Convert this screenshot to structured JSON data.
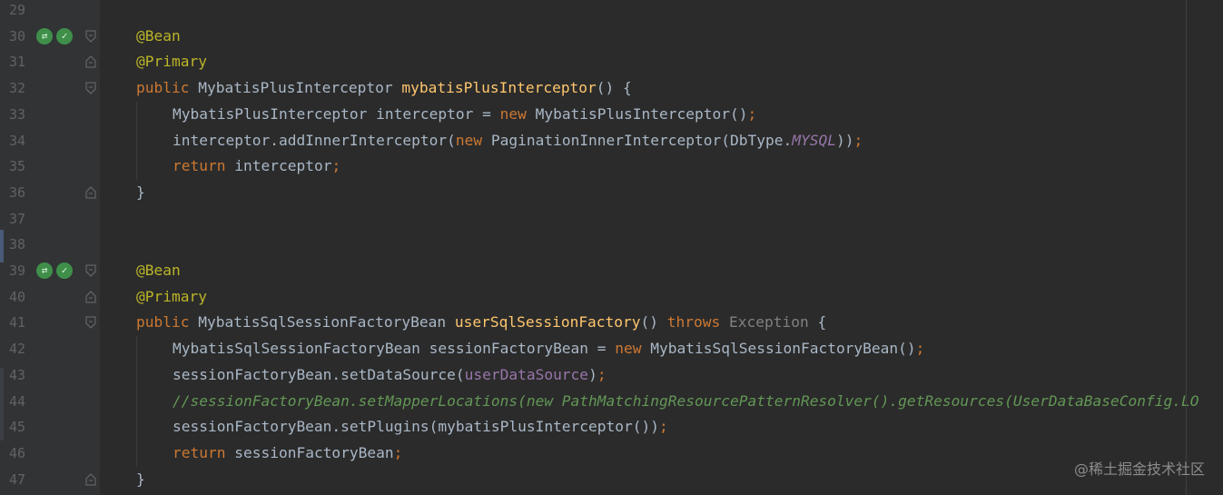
{
  "editor": {
    "lines": [
      {
        "num": "29",
        "icons": false,
        "fold": "",
        "indent": 0,
        "segments": []
      },
      {
        "num": "30",
        "icons": true,
        "fold": "open",
        "indent": 0,
        "segments": [
          {
            "t": "@Bean",
            "c": "ann"
          }
        ]
      },
      {
        "num": "31",
        "icons": false,
        "fold": "close",
        "indent": 0,
        "segments": [
          {
            "t": "@Primary",
            "c": "ann"
          }
        ]
      },
      {
        "num": "32",
        "icons": false,
        "fold": "open",
        "indent": 0,
        "segments": [
          {
            "t": "public ",
            "c": "kw"
          },
          {
            "t": "MybatisPlusInterceptor ",
            "c": "cls"
          },
          {
            "t": "mybatisPlusInterceptor",
            "c": "fn"
          },
          {
            "t": "() {",
            "c": "cls"
          }
        ]
      },
      {
        "num": "33",
        "icons": false,
        "fold": "",
        "indent": 1,
        "segments": [
          {
            "t": "MybatisPlusInterceptor interceptor = ",
            "c": "cls"
          },
          {
            "t": "new ",
            "c": "kw"
          },
          {
            "t": "MybatisPlusInterceptor()",
            "c": "cls"
          },
          {
            "t": ";",
            "c": "kw"
          }
        ]
      },
      {
        "num": "34",
        "icons": false,
        "fold": "",
        "indent": 1,
        "segments": [
          {
            "t": "interceptor.addInnerInterceptor(",
            "c": "cls"
          },
          {
            "t": "new ",
            "c": "kw"
          },
          {
            "t": "PaginationInnerInterceptor(DbType.",
            "c": "cls"
          },
          {
            "t": "MYSQL",
            "c": "field"
          },
          {
            "t": "))",
            "c": "cls"
          },
          {
            "t": ";",
            "c": "kw"
          }
        ]
      },
      {
        "num": "35",
        "icons": false,
        "fold": "",
        "indent": 1,
        "segments": [
          {
            "t": "return ",
            "c": "kw"
          },
          {
            "t": "interceptor",
            "c": "cls"
          },
          {
            "t": ";",
            "c": "kw"
          }
        ]
      },
      {
        "num": "36",
        "icons": false,
        "fold": "close",
        "indent": 0,
        "segments": [
          {
            "t": "}",
            "c": "cls"
          }
        ]
      },
      {
        "num": "37",
        "icons": false,
        "fold": "",
        "indent": 0,
        "segments": []
      },
      {
        "num": "38",
        "icons": false,
        "fold": "",
        "indent": 0,
        "segments": []
      },
      {
        "num": "39",
        "icons": true,
        "fold": "open",
        "indent": 0,
        "segments": [
          {
            "t": "@Bean",
            "c": "ann"
          }
        ]
      },
      {
        "num": "40",
        "icons": false,
        "fold": "close",
        "indent": 0,
        "segments": [
          {
            "t": "@Primary",
            "c": "ann"
          }
        ]
      },
      {
        "num": "41",
        "icons": false,
        "fold": "open",
        "indent": 0,
        "segments": [
          {
            "t": "public ",
            "c": "kw"
          },
          {
            "t": "MybatisSqlSessionFactoryBean ",
            "c": "cls"
          },
          {
            "t": "userSqlSessionFactory",
            "c": "fn"
          },
          {
            "t": "() ",
            "c": "cls"
          },
          {
            "t": "throws ",
            "c": "kw"
          },
          {
            "t": "Exception ",
            "c": "muted"
          },
          {
            "t": "{",
            "c": "cls"
          }
        ]
      },
      {
        "num": "42",
        "icons": false,
        "fold": "",
        "indent": 1,
        "segments": [
          {
            "t": "MybatisSqlSessionFactoryBean sessionFactoryBean = ",
            "c": "cls"
          },
          {
            "t": "new ",
            "c": "kw"
          },
          {
            "t": "MybatisSqlSessionFactoryBean()",
            "c": "cls"
          },
          {
            "t": ";",
            "c": "kw"
          }
        ]
      },
      {
        "num": "43",
        "icons": false,
        "fold": "",
        "indent": 1,
        "segments": [
          {
            "t": "sessionFactoryBean.setDataSource(",
            "c": "cls"
          },
          {
            "t": "userDataSource",
            "c": "param"
          },
          {
            "t": ")",
            "c": "cls"
          },
          {
            "t": ";",
            "c": "kw"
          }
        ]
      },
      {
        "num": "44",
        "icons": false,
        "fold": "",
        "indent": 1,
        "segments": [
          {
            "t": "//sessionFactoryBean.setMapperLocations(new PathMatchingResourcePatternResolver().getResources(UserDataBaseConfig.LO",
            "c": "cmt"
          }
        ]
      },
      {
        "num": "45",
        "icons": false,
        "fold": "",
        "indent": 1,
        "segments": [
          {
            "t": "sessionFactoryBean.setPlugins(mybatisPlusInterceptor())",
            "c": "cls"
          },
          {
            "t": ";",
            "c": "kw"
          }
        ]
      },
      {
        "num": "46",
        "icons": false,
        "fold": "",
        "indent": 1,
        "segments": [
          {
            "t": "return ",
            "c": "kw"
          },
          {
            "t": "sessionFactoryBean",
            "c": "cls"
          },
          {
            "t": ";",
            "c": "kw"
          }
        ]
      },
      {
        "num": "47",
        "icons": false,
        "fold": "close",
        "indent": 0,
        "segments": [
          {
            "t": "}",
            "c": "cls"
          }
        ]
      }
    ]
  },
  "watermark": "@稀土掘金技术社区",
  "colors": {
    "background": "#2b2b2b",
    "gutter": "#313335",
    "keyword": "#cc7832",
    "annotation": "#bbb529",
    "method": "#ffc66d",
    "comment": "#629755",
    "field": "#9876aa"
  }
}
